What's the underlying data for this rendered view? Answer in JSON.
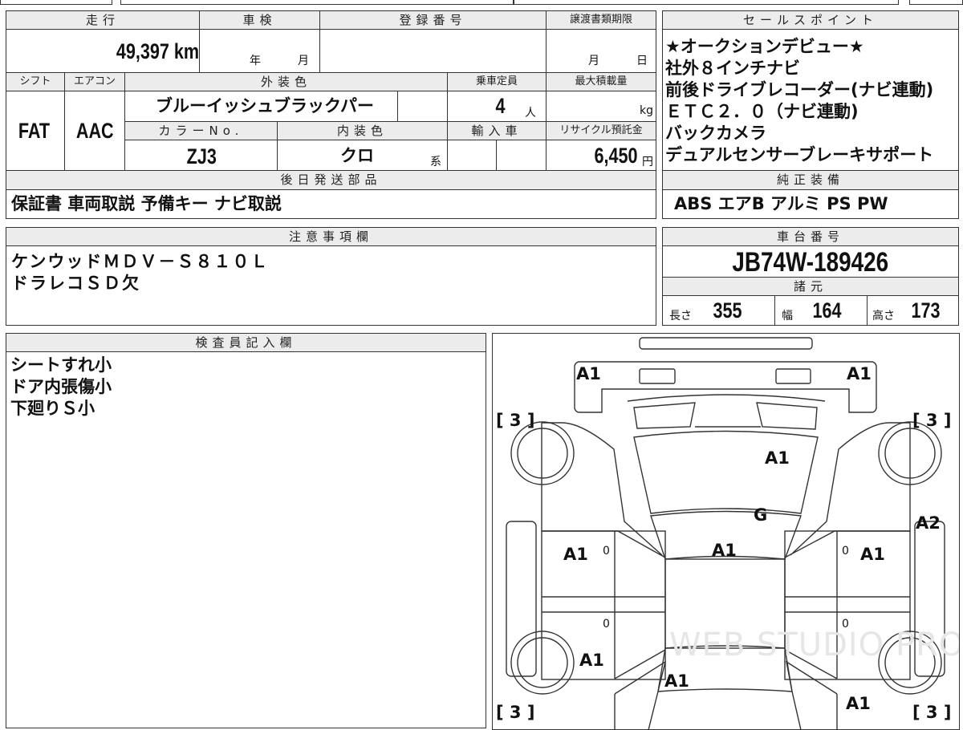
{
  "mileage": {
    "label": "走行",
    "value": "49,397",
    "unit": "km"
  },
  "shaken": {
    "label": "車検",
    "year": "年",
    "month": "月"
  },
  "registration": {
    "label": "登録番号"
  },
  "transfer_deadline": {
    "label": "譲渡書類期限",
    "month": "月",
    "day": "日"
  },
  "shift": {
    "label": "シフト",
    "value": "FAT"
  },
  "aircon": {
    "label": "エアコン",
    "value": "AAC"
  },
  "exterior_color": {
    "label": "外装色",
    "value": "ブルーイッシュブラックパー"
  },
  "capacity": {
    "label": "乗車定員",
    "value": "4",
    "unit": "人"
  },
  "max_load": {
    "label": "最大積載量",
    "unit": "kg"
  },
  "color_no": {
    "label": "カラーNo.",
    "value": "ZJ3"
  },
  "interior_color": {
    "label": "内装色",
    "value": "クロ",
    "suffix": "系"
  },
  "import": {
    "label": "輸入車"
  },
  "recycle": {
    "label": "リサイクル預託金",
    "value": "6,450",
    "unit": "円"
  },
  "later_parts": {
    "label": "後日発送部品",
    "value": "保証書 車両取説 予備キー ナビ取説"
  },
  "sales_points": {
    "label": "セールスポイント",
    "lines": [
      "★オークションデビュー★",
      "社外８インチナビ",
      "前後ドライブレコーダー(ナビ連動)",
      "ＥＴＣ２．０（ナビ連動)",
      "バックカメラ",
      "デュアルセンサーブレーキサポート"
    ]
  },
  "equipment": {
    "label": "純正装備",
    "value": "ABS エアB アルミ PS PW"
  },
  "notes": {
    "label": "注意事項欄",
    "lines": [
      "ケンウッドＭＤＶ－Ｓ８１０Ｌ",
      "ドラレコＳＤ欠"
    ]
  },
  "chassis": {
    "label": "車台番号",
    "value": "JB74W-189426"
  },
  "specs": {
    "label": "諸元",
    "length_label": "長さ",
    "length": "355",
    "width_label": "幅",
    "width": "164",
    "height_label": "高さ",
    "height": "173"
  },
  "inspector": {
    "label": "検査員記入欄",
    "lines": [
      "シートすれ小",
      "ドア内張傷小",
      "下廻りＳ小"
    ]
  },
  "diagram": {
    "marks": [
      "A1",
      "A1",
      "A1",
      "G",
      "A1",
      "A1",
      "A2",
      "A1",
      "A1",
      "A1",
      "A1"
    ],
    "tires": [
      "[ 3 ]",
      "[ 3 ]",
      "[ 3 ]",
      "[ 3 ]"
    ],
    "zeros": [
      "0",
      "0",
      "0",
      "0"
    ],
    "watermark": "WEB STUDIO PRO"
  }
}
